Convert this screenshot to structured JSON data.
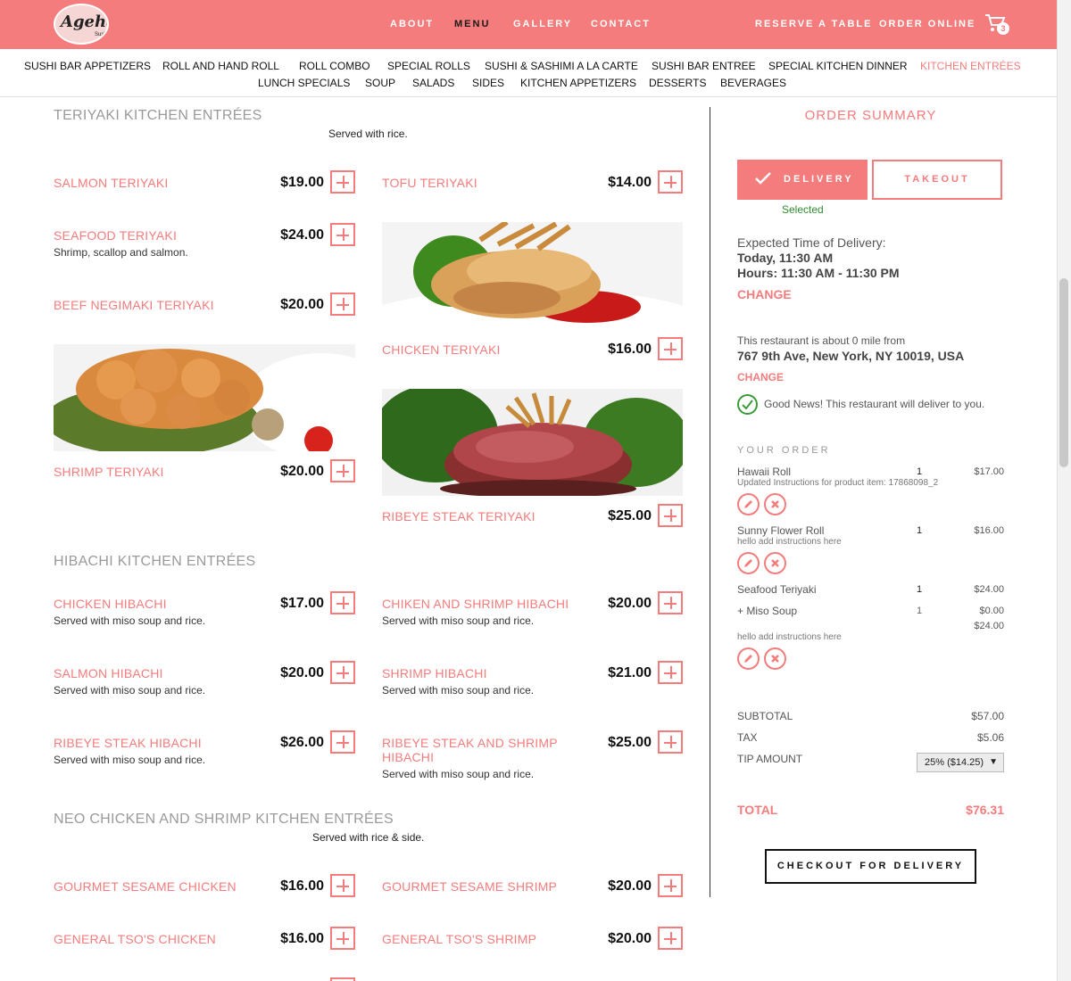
{
  "header": {
    "logo": "Ageha",
    "logo_sub": "Sushi",
    "nav": [
      {
        "label": "ABOUT"
      },
      {
        "label": "MENU"
      },
      {
        "label": "GALLERY"
      },
      {
        "label": "CONTACT"
      },
      {
        "label": "RESERVE A TABLE"
      },
      {
        "label": "ORDER ONLINE"
      }
    ],
    "cart_count": "3"
  },
  "categories": [
    "SUSHI BAR APPETIZERS",
    "ROLL AND HAND ROLL",
    "ROLL COMBO",
    "SPECIAL ROLLS",
    "SUSHI & SASHIMI A LA CARTE",
    "SUSHI BAR ENTREE",
    "SPECIAL KITCHEN DINNER",
    "KITCHEN ENTRÉES",
    "LUNCH SPECIALS",
    "SOUP",
    "SALADS",
    "SIDES",
    "KITCHEN APPETIZERS",
    "DESSERTS",
    "BEVERAGES"
  ],
  "sections": [
    {
      "title": "TERIYAKI KITCHEN ENTRÉES",
      "note": "Served with rice.",
      "items": [
        {
          "name": "SALMON TERIYAKI",
          "price": "$19.00",
          "desc": ""
        },
        {
          "name": "TOFU TERIYAKI",
          "price": "$14.00",
          "desc": ""
        },
        {
          "name": "SEAFOOD TERIYAKI",
          "price": "$24.00",
          "desc": "Shrimp, scallop and salmon."
        },
        {
          "name": "BEEF NEGIMAKI TERIYAKI",
          "price": "$20.00",
          "desc": ""
        },
        {
          "name": "CHICKEN TERIYAKI",
          "price": "$16.00",
          "desc": ""
        },
        {
          "name": "SHRIMP TERIYAKI",
          "price": "$20.00",
          "desc": ""
        },
        {
          "name": "RIBEYE STEAK TERIYAKI",
          "price": "$25.00",
          "desc": ""
        }
      ]
    },
    {
      "title": "HIBACHI KITCHEN ENTRÉES",
      "items": [
        {
          "name": "CHICKEN HIBACHI",
          "price": "$17.00",
          "desc": "Served with miso soup and rice."
        },
        {
          "name": "CHIKEN AND SHRIMP HIBACHI",
          "price": "$20.00",
          "desc": "Served with miso soup and rice."
        },
        {
          "name": "SALMON HIBACHI",
          "price": "$20.00",
          "desc": "Served with miso soup and rice."
        },
        {
          "name": "SHRIMP HIBACHI",
          "price": "$21.00",
          "desc": "Served with miso soup and rice."
        },
        {
          "name": "RIBEYE STEAK HIBACHI",
          "price": "$26.00",
          "desc": "Served with miso soup and rice."
        },
        {
          "name": "RIBEYE STEAK AND SHRIMP HIBACHI",
          "price": "$25.00",
          "desc": "Served with miso soup and rice."
        }
      ]
    },
    {
      "title": "NEO CHICKEN AND SHRIMP KITCHEN ENTRÉES",
      "note": "Served with rice & side.",
      "items": [
        {
          "name": "GOURMET SESAME CHICKEN",
          "price": "$16.00"
        },
        {
          "name": "GOURMET SESAME SHRIMP",
          "price": "$20.00"
        },
        {
          "name": "GENERAL TSO'S CHICKEN",
          "price": "$16.00"
        },
        {
          "name": "GENERAL TSO'S SHRIMP",
          "price": "$20.00"
        }
      ]
    }
  ],
  "order_summary": {
    "title": "ORDER SUMMARY",
    "delivery_label": "DELIVERY",
    "takeout_label": "TAKEOUT",
    "selected_text": "Selected",
    "expected_label": "Expected Time of Delivery:",
    "expected_time": "Today, 11:30 AM",
    "hours": "Hours: 11:30 AM - 11:30 PM",
    "change_label": "CHANGE",
    "distance_text": "This restaurant is about 0 mile from",
    "address": "767 9th Ave, New York, NY 10019, USA",
    "good_news": "Good News! This restaurant will deliver to you.",
    "your_order_label": "YOUR ORDER",
    "items": [
      {
        "name": "Hawaii Roll",
        "qty": "1",
        "price": "$17.00",
        "note": "Updated Instructions for product item: 17868098_2"
      },
      {
        "name": "Sunny Flower Roll",
        "qty": "1",
        "price": "$16.00",
        "note": "hello add instructions here"
      },
      {
        "name": "Seafood Teriyaki",
        "qty": "1",
        "price": "$24.00",
        "addon": "+ Miso Soup",
        "addon_qty": "1",
        "addon_price": "$0.00",
        "line_total": "$24.00",
        "note": "hello add instructions here"
      }
    ],
    "subtotal_label": "SUBTOTAL",
    "subtotal": "$57.00",
    "tax_label": "TAX",
    "tax": "$5.06",
    "tip_label": "TIP AMOUNT",
    "tip_selected": "25% ($14.25)",
    "total_label": "TOTAL",
    "total": "$76.31",
    "checkout_label": "CHECKOUT FOR DELIVERY"
  },
  "colors": {
    "accent": "#f47c7c",
    "selected_green": "#2e8b2e"
  }
}
